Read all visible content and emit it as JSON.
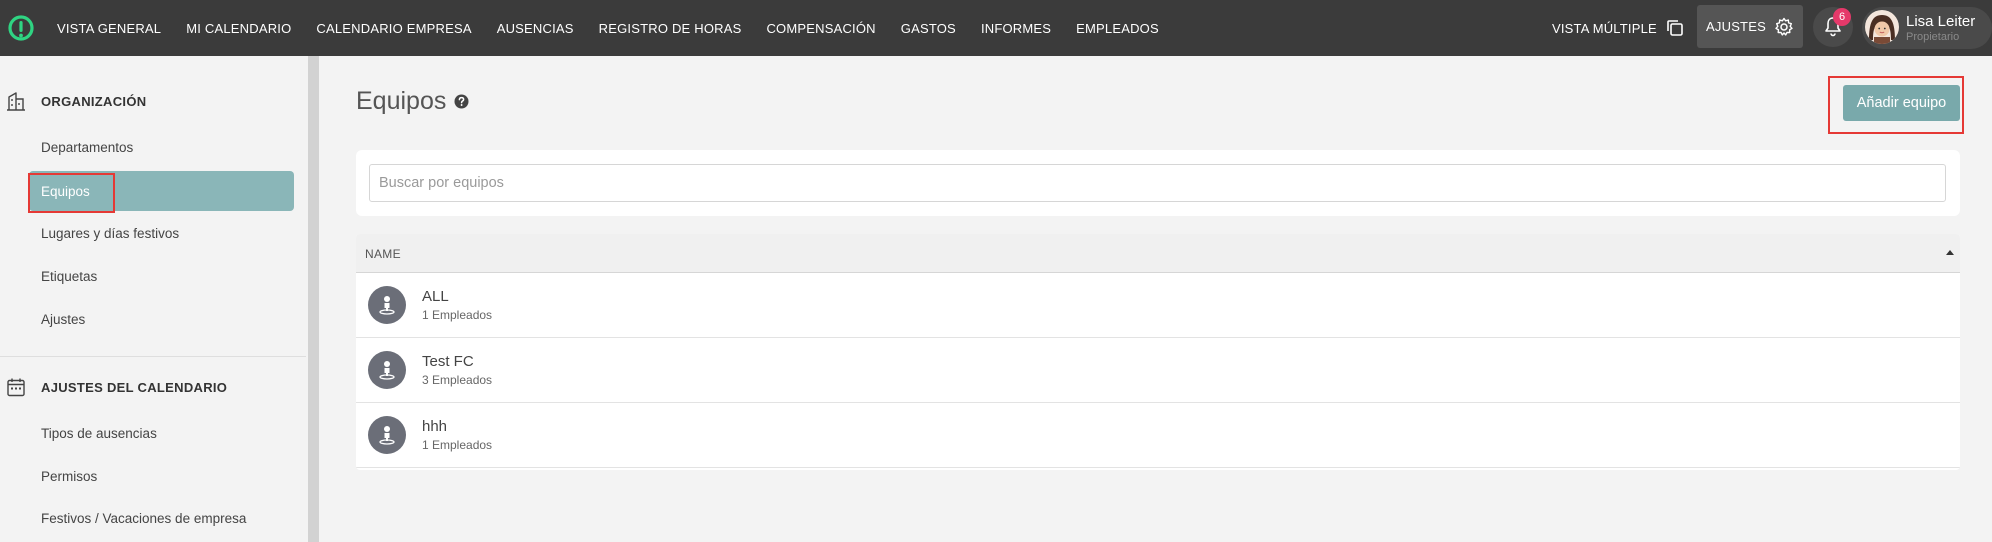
{
  "colors": {
    "topbar": "#3b3b3b",
    "accent": "#79a9ab",
    "active": "#8ab6b8",
    "badge": "#e5396a",
    "logo": "#2fd482"
  },
  "nav": {
    "items": [
      "VISTA GENERAL",
      "MI CALENDARIO",
      "CALENDARIO EMPRESA",
      "AUSENCIAS",
      "REGISTRO DE HORAS",
      "COMPENSACIÓN",
      "GASTOS",
      "INFORMES",
      "EMPLEADOS"
    ],
    "multi_view": "VISTA MÚLTIPLE",
    "settings": "AJUSTES",
    "notifications": "6",
    "user_name": "Lisa Leiter",
    "user_role": "Propietario"
  },
  "sidebar": {
    "org_title": "ORGANIZACIÓN",
    "org_items": [
      "Departamentos",
      "Equipos",
      "Lugares y días festivos",
      "Etiquetas",
      "Ajustes"
    ],
    "cal_title": "AJUSTES DEL CALENDARIO",
    "cal_items": [
      "Tipos de ausencias",
      "Permisos",
      "Festivos / Vacaciones de empresa"
    ]
  },
  "main": {
    "title": "Equipos",
    "add_button": "Añadir equipo",
    "search_placeholder": "Buscar por equipos",
    "table": {
      "column": "NAME",
      "rows": [
        {
          "name": "ALL",
          "count": "1 Empleados"
        },
        {
          "name": "Test FC",
          "count": "3 Empleados"
        },
        {
          "name": "hhh",
          "count": "1 Empleados"
        }
      ]
    }
  }
}
